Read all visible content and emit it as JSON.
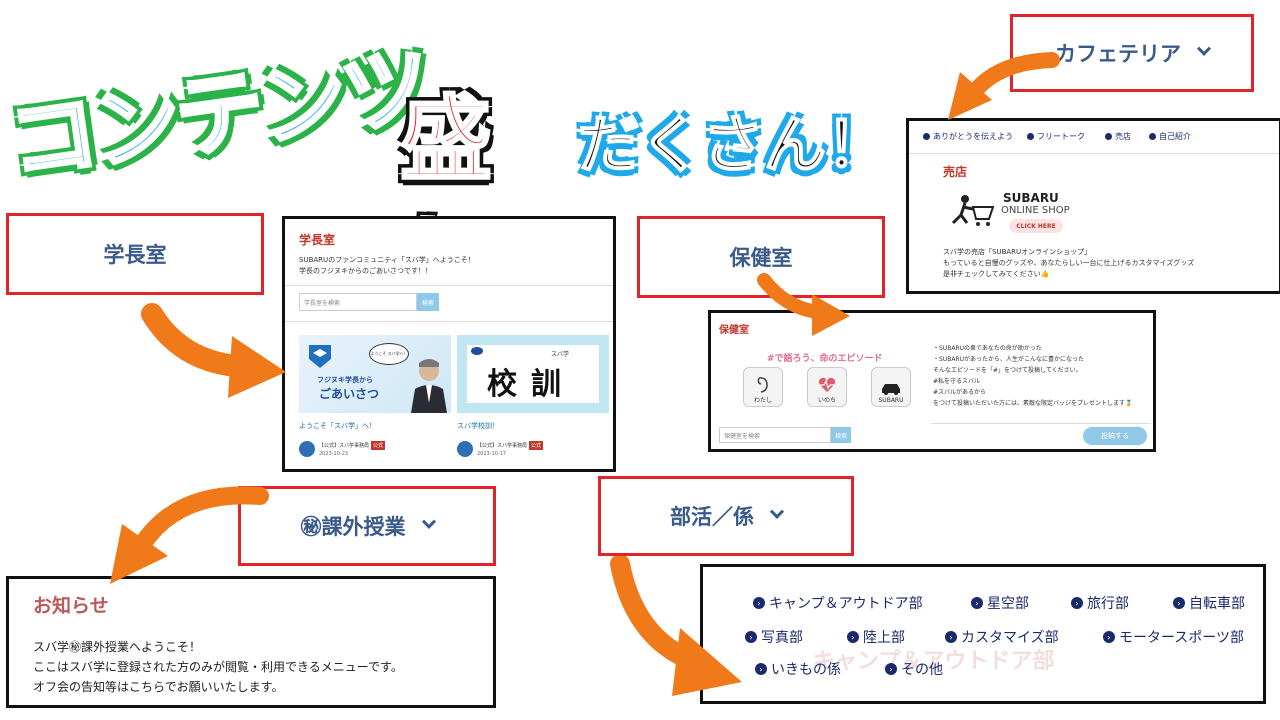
{
  "headline": {
    "part1": "コンテンツ",
    "part2": "盛り",
    "part3": "だくさん！"
  },
  "labels": {
    "cafeteria": "カフェテリア",
    "gakucho": "学長室",
    "hoken": "保健室",
    "kagai": "㊙課外授業",
    "bukatsu": "部活／係"
  },
  "cafe_panel": {
    "nav": [
      "ありがとうを伝えよう",
      "フリートーク",
      "売店",
      "自己紹介"
    ],
    "title": "売店",
    "logo_line1": "SUBARU",
    "logo_line2": "ONLINE SHOP",
    "logo_btn": "CLICK HERE",
    "desc1": "スバ学の売店「SUBARUオンラインショップ」",
    "desc2": "もっていると自慢のグッズや、あなたらしい一台に仕上げるカスタマイズグッズ",
    "desc3": "是非チェックしてみてください👍"
  },
  "gakucho_panel": {
    "title": "学長室",
    "intro1": "SUBARUのファンコミュニティ「スバ学」へようこそ！",
    "intro2": "学長のフジヌキからのごあいさつです！！",
    "search_placeholder": "学長室を検索",
    "search_btn": "検索",
    "card1": {
      "bubble": "ようこそ スバ学へ！",
      "img_line1": "フジヌキ学長から",
      "img_line2": "ごあいさつ",
      "caption": "ようこそ「スバ学」へ！",
      "author": "【公式】スバ学事務局",
      "badge": "公式",
      "date": "2023-10-23"
    },
    "card2": {
      "img_small": "スバ学",
      "img_big": "校訓",
      "caption": "スバ学校訓！",
      "author": "【公式】スバ学事務局",
      "badge": "公式",
      "date": "2023-10-17"
    }
  },
  "hoken_panel": {
    "title": "保健室",
    "tagline": "#で語ろう、命のエピソード",
    "tiles": [
      "わたし",
      "いのち",
      "SUBARU"
    ],
    "lines": [
      "・SUBARUの車であなたの命が助かった",
      "・SUBARUがあったから、人生がこんなに豊かになった",
      "そんなエピソードを「#」をつけて投稿してください。",
      "#私を守るスバル",
      "#スバルがあるから",
      "をつけて投稿いただいた方には、素敵な限定バッジをプレゼントします🏅"
    ],
    "search_placeholder": "保健室を検索",
    "search_btn": "検索",
    "post_btn": "投稿する"
  },
  "notice_panel": {
    "title": "お知らせ",
    "line1": "スバ学㊙課外授業へようこそ！",
    "line2": "ここはスバ学に登録された方のみが閲覧・利用できるメニューです。",
    "line3": "オフ会の告知等はこちらでお願いいたします。"
  },
  "club_panel": {
    "items": [
      "キャンプ＆アウトドア部",
      "星空部",
      "旅行部",
      "自転車部",
      "写真部",
      "陸上部",
      "カスタマイズ部",
      "モータースポーツ部",
      "いきもの係",
      "その他"
    ],
    "ghost": "キャンプ＆アウトドア部"
  },
  "colors": {
    "accent_red": "#e0242a",
    "arrow": "#f07a1a",
    "link_navy": "#1a2a6c",
    "label_blue": "#3a5a8c"
  }
}
